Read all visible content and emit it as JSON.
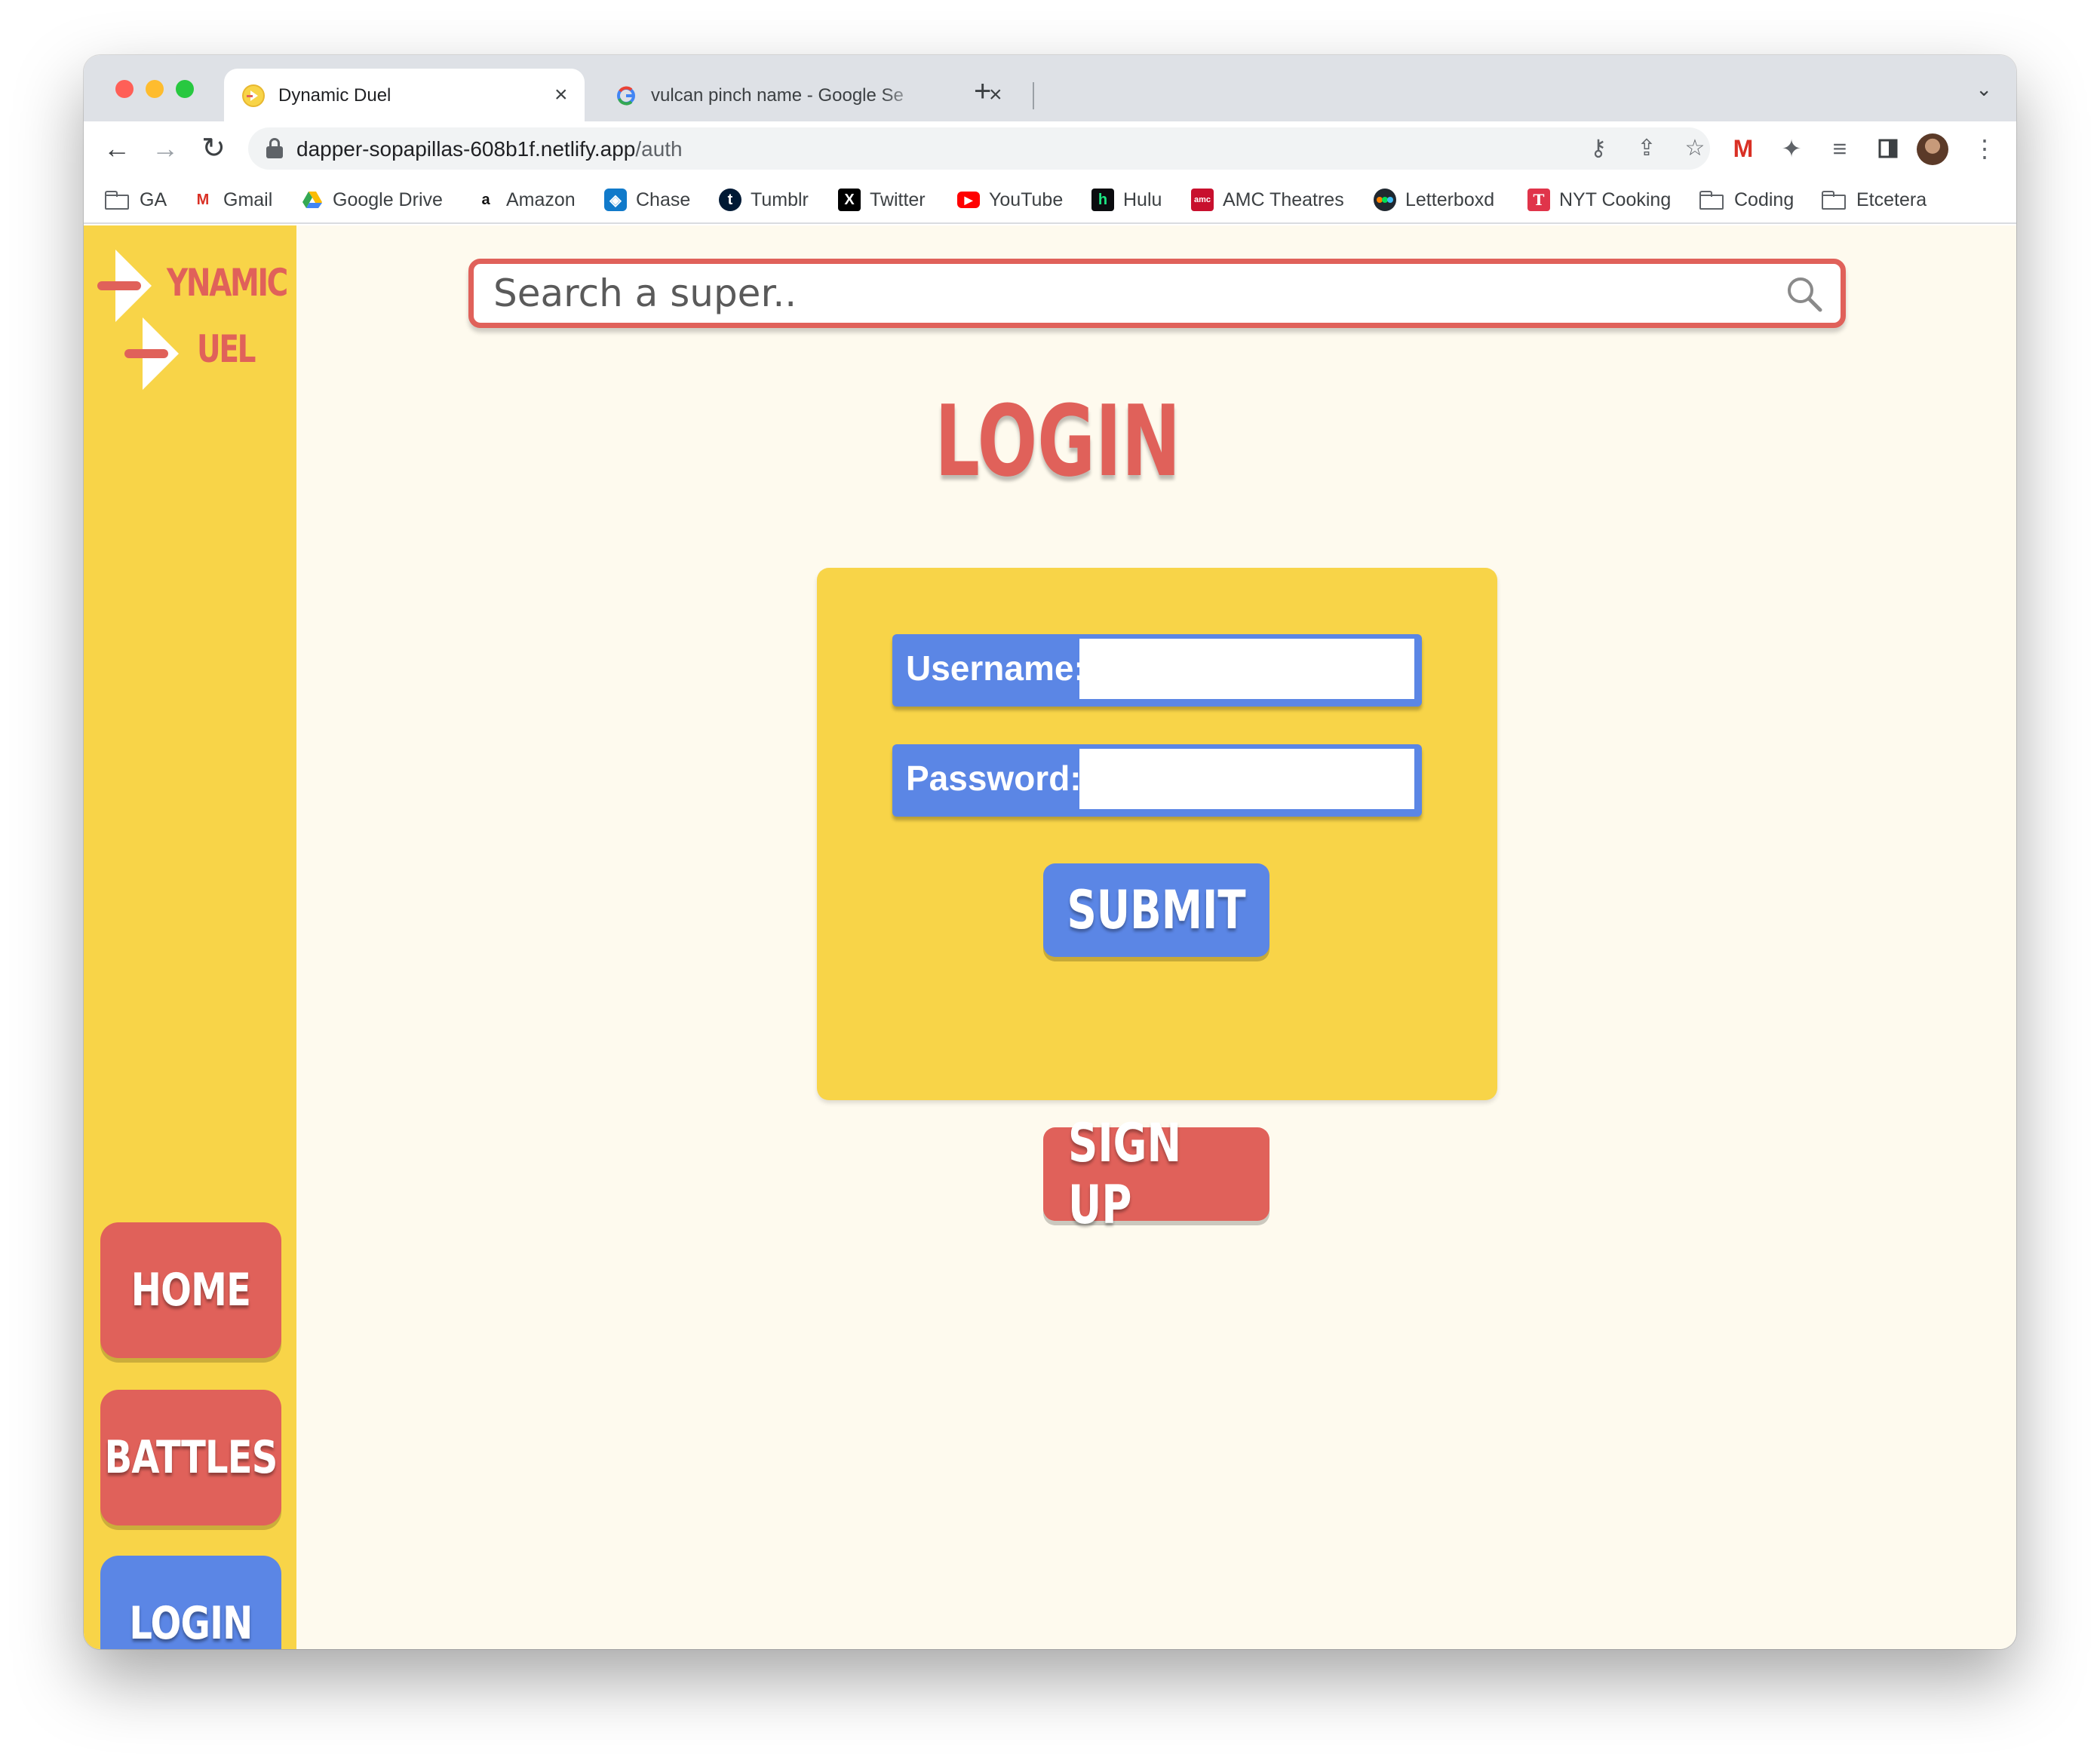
{
  "browser": {
    "tabs": [
      {
        "title": "Dynamic Duel",
        "active": true
      },
      {
        "title": "vulcan pinch name - Google Se",
        "active": false
      }
    ],
    "url_host": "dapper-sopapillas-608b1f.netlify.app",
    "url_path": "/auth",
    "bookmarks": [
      {
        "label": "GA",
        "icon": "folder-icon"
      },
      {
        "label": "Gmail",
        "icon": "gmail-icon"
      },
      {
        "label": "Google Drive",
        "icon": "google-drive-icon"
      },
      {
        "label": "Amazon",
        "icon": "amazon-icon"
      },
      {
        "label": "Chase",
        "icon": "chase-icon"
      },
      {
        "label": "Tumblr",
        "icon": "tumblr-icon"
      },
      {
        "label": "Twitter",
        "icon": "x-icon"
      },
      {
        "label": "YouTube",
        "icon": "youtube-icon"
      },
      {
        "label": "Hulu",
        "icon": "hulu-icon"
      },
      {
        "label": "AMC Theatres",
        "icon": "amc-icon"
      },
      {
        "label": "Letterboxd",
        "icon": "letterboxd-icon"
      },
      {
        "label": "NYT Cooking",
        "icon": "nyt-cooking-icon"
      },
      {
        "label": "Coding",
        "icon": "folder-icon"
      },
      {
        "label": "Etcetera",
        "icon": "folder-icon"
      }
    ]
  },
  "app": {
    "logo": {
      "line1": "YNAMIC",
      "line2": "UEL"
    },
    "search": {
      "placeholder": "Search a super.."
    },
    "page_title": "LOGIN",
    "form": {
      "username_label": "Username:",
      "username_value": "",
      "password_label": "Password:",
      "password_value": "",
      "submit_label": "SUBMIT"
    },
    "signup_label": "SIGN UP",
    "nav": {
      "home": "HOME",
      "battles": "BATTLES",
      "login": "LOGIN"
    }
  },
  "colors": {
    "sidebar_yellow": "#f8d448",
    "accent_red": "#e0615a",
    "accent_blue": "#5b86e5",
    "page_bg": "#fefaee"
  }
}
